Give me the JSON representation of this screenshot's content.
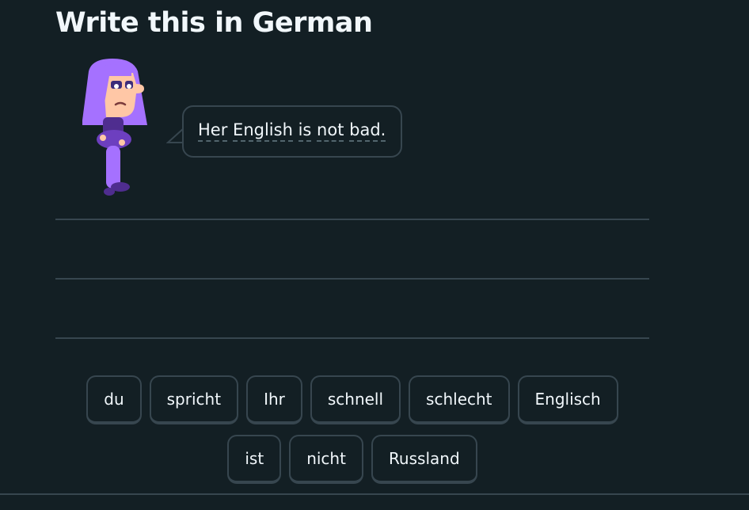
{
  "header": {
    "title": "Write this in German"
  },
  "prompt": {
    "character_icon": "lily-character-icon",
    "words": [
      "Her",
      "English",
      "is",
      "not",
      "bad."
    ]
  },
  "word_bank": {
    "row1": [
      "du",
      "spricht",
      "Ihr",
      "schnell",
      "schlecht",
      "Englisch"
    ],
    "row2": [
      "ist",
      "nicht",
      "Russland"
    ]
  },
  "colors": {
    "background": "#131f24",
    "border": "#37464f",
    "text": "#f1f7fb",
    "character_purple": "#a571ff"
  }
}
